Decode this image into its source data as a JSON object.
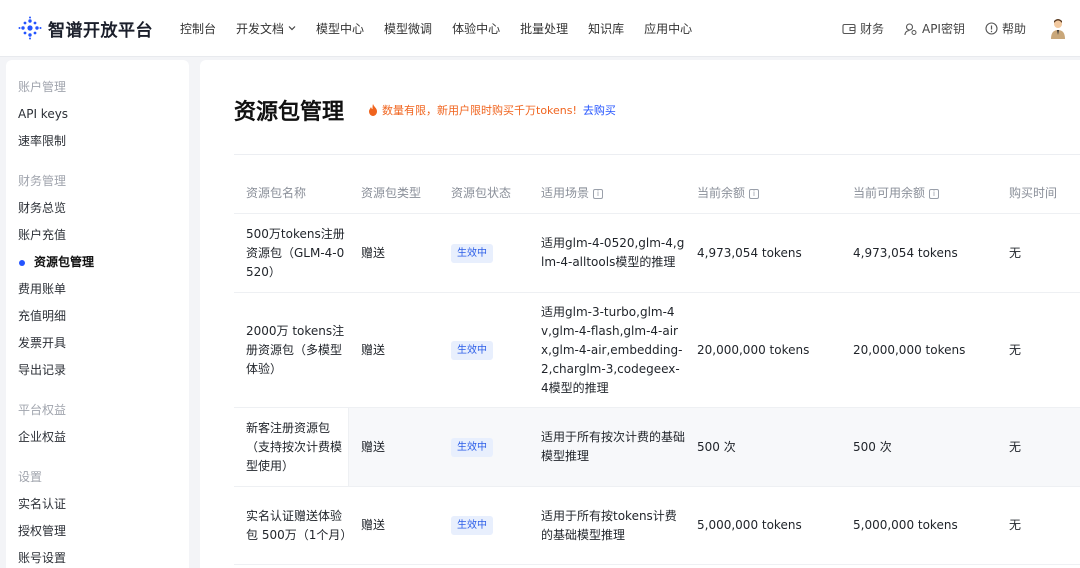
{
  "brand": {
    "name": "智谱开放平台"
  },
  "nav": [
    {
      "label": "控制台"
    },
    {
      "label": "开发文档"
    },
    {
      "label": "模型中心"
    },
    {
      "label": "模型微调"
    },
    {
      "label": "体验中心"
    },
    {
      "label": "批量处理"
    },
    {
      "label": "知识库"
    },
    {
      "label": "应用中心"
    }
  ],
  "tools": {
    "finance": "财务",
    "api_key": "API密钥",
    "help": "帮助"
  },
  "sidebar": {
    "groups": [
      {
        "label": "账户管理",
        "items": [
          "API keys",
          "速率限制"
        ]
      },
      {
        "label": "财务管理",
        "items": [
          "财务总览",
          "账户充值",
          "资源包管理",
          "费用账单",
          "充值明细",
          "发票开具",
          "导出记录"
        ]
      },
      {
        "label": "平台权益",
        "items": [
          "企业权益"
        ]
      },
      {
        "label": "设置",
        "items": [
          "实名认证",
          "授权管理",
          "账号设置"
        ]
      }
    ],
    "active": "资源包管理"
  },
  "page": {
    "title": "资源包管理",
    "promo_text": "数量有限，新用户限时购买千万tokens!",
    "promo_link": "去购买"
  },
  "table": {
    "columns": [
      "资源包名称",
      "资源包类型",
      "资源包状态",
      "适用场景",
      "当前余额",
      "当前可用余额",
      "购买时间"
    ],
    "rows": [
      {
        "name": "500万tokens注册资源包（GLM-4-0520）",
        "type": "赠送",
        "status": "生效中",
        "scene": "适用glm-4-0520,glm-4,glm-4-alltools模型的推理",
        "balance": "4,973,054 tokens",
        "available": "4,973,054 tokens",
        "time": "无"
      },
      {
        "name": "2000万 tokens注册资源包（多模型体验）",
        "type": "赠送",
        "status": "生效中",
        "scene": "适用glm-3-turbo,glm-4v,glm-4-flash,glm-4-airx,glm-4-air,embedding-2,charglm-3,codegeex-4模型的推理",
        "balance": "20,000,000 tokens",
        "available": "20,000,000 tokens",
        "time": "无"
      },
      {
        "name": "新客注册资源包（支持按次计费模型使用）",
        "type": "赠送",
        "status": "生效中",
        "scene": "适用于所有按次计费的基础模型推理",
        "balance": "500 次",
        "available": "500 次",
        "time": "无"
      },
      {
        "name": "实名认证赠送体验包 500万（1个月）",
        "type": "赠送",
        "status": "生效中",
        "scene": "适用于所有按tokens计费的基础模型推理",
        "balance": "5,000,000 tokens",
        "available": "5,000,000 tokens",
        "time": "无"
      }
    ]
  }
}
